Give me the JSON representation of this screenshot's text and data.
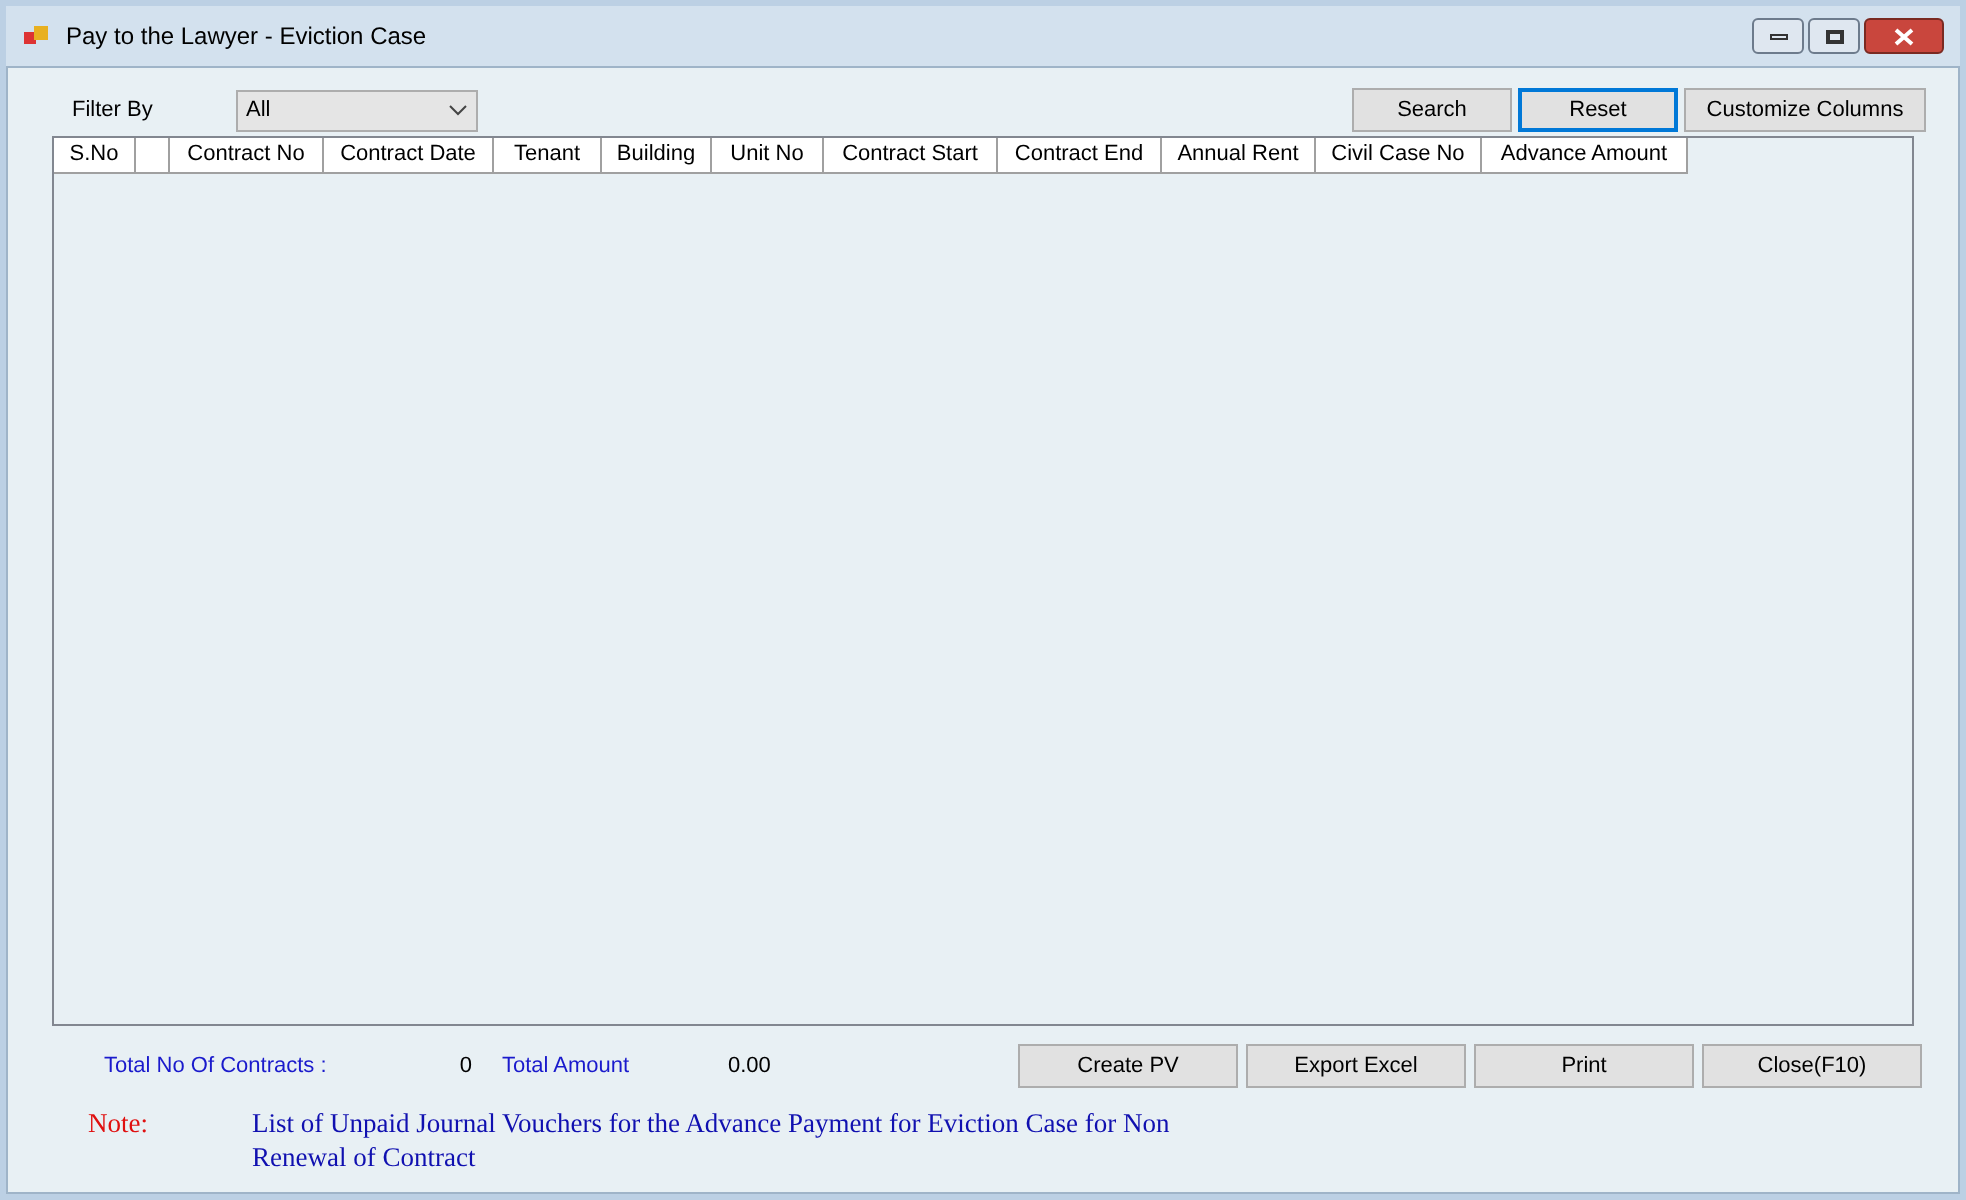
{
  "window": {
    "title": "Pay to the Lawyer - Eviction Case"
  },
  "filter": {
    "label": "Filter By",
    "value": "All"
  },
  "top_buttons": [
    {
      "label": "Search",
      "focused": false
    },
    {
      "label": "Reset",
      "focused": true
    },
    {
      "label": "Customize Columns",
      "focused": false
    }
  ],
  "table": {
    "columns": [
      "S.No",
      "",
      "Contract No",
      "Contract Date",
      "Tenant",
      "Building",
      "Unit No",
      "Contract Start",
      "Contract End",
      "Annual Rent",
      "Civil Case No",
      "Advance Amount"
    ]
  },
  "totals": {
    "contracts_label": "Total No Of Contracts :",
    "contracts_value": "0",
    "amount_label": "Total Amount",
    "amount_value": "0.00"
  },
  "bottom_buttons": [
    "Create PV",
    "Export Excel",
    "Print",
    "Close(F10)"
  ],
  "note": {
    "label": "Note:",
    "text": "List of Unpaid Journal Vouchers for the Advance Payment for Eviction Case for Non Renewal of Contract"
  }
}
